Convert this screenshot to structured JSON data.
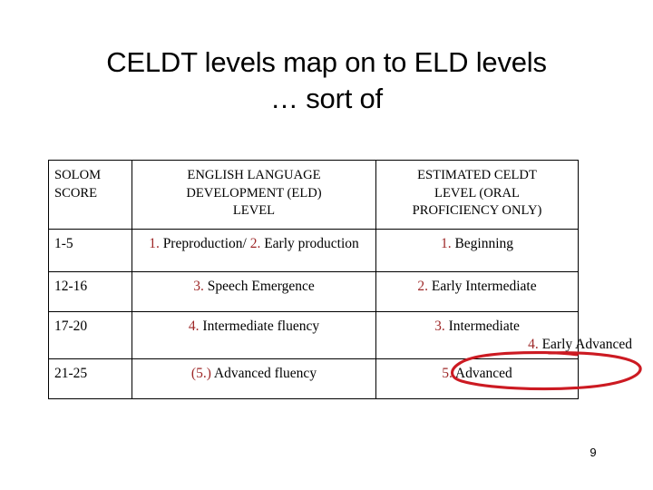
{
  "slide": {
    "title_line1": "CELDT levels map on to ELD levels",
    "title_line2": "… sort of",
    "page_number": "9",
    "colors": {
      "text": "#000000",
      "table_border": "#000000",
      "level_number_red": "#9E2828",
      "annotation_red": "#CC1A22",
      "background": "#FFFFFF"
    }
  },
  "table": {
    "headers": [
      "SOLOM SCORE",
      "ENGLISH LANGUAGE DEVELOPMENT (ELD) LEVEL",
      "ESTIMATED CELDT LEVEL (ORAL PROFICIENCY ONLY)"
    ],
    "headers_wrapped": {
      "col1_line1": "SOLOM",
      "col1_line2": "SCORE",
      "col2_line1": "ENGLISH LANGUAGE",
      "col2_line2": "DEVELOPMENT (ELD)",
      "col2_line3": "LEVEL",
      "col3_line1": "ESTIMATED CELDT",
      "col3_line2": "LEVEL (ORAL",
      "col3_line3": "PROFICIENCY ONLY)"
    },
    "rows": [
      {
        "score": "1-5",
        "eld_num1": "1.",
        "eld_text1": " Preproduction/ ",
        "eld_num2": "2.",
        "eld_text2": " Early production",
        "celdt_num": "1.",
        "celdt_text": " Beginning"
      },
      {
        "score": "12-16",
        "eld_num1": "3.",
        "eld_text1": " Speech Emergence",
        "celdt_num": "2.",
        "celdt_text": "  Early Intermediate"
      },
      {
        "score": "17-20",
        "eld_num1": "4.",
        "eld_text1": " Intermediate fluency",
        "celdt_num": "3.",
        "celdt_text": " Intermediate",
        "celdt_num_2": "4.",
        "celdt_text_2": " Early Advanced"
      },
      {
        "score": "21-25",
        "eld_num1": "(5.)",
        "eld_text1": " Advanced fluency",
        "celdt_num": "5.",
        "celdt_text": " Advanced"
      }
    ]
  },
  "annotation": {
    "shape": "hand-drawn-red-ellipse",
    "encircles": "4. Early Advanced"
  }
}
